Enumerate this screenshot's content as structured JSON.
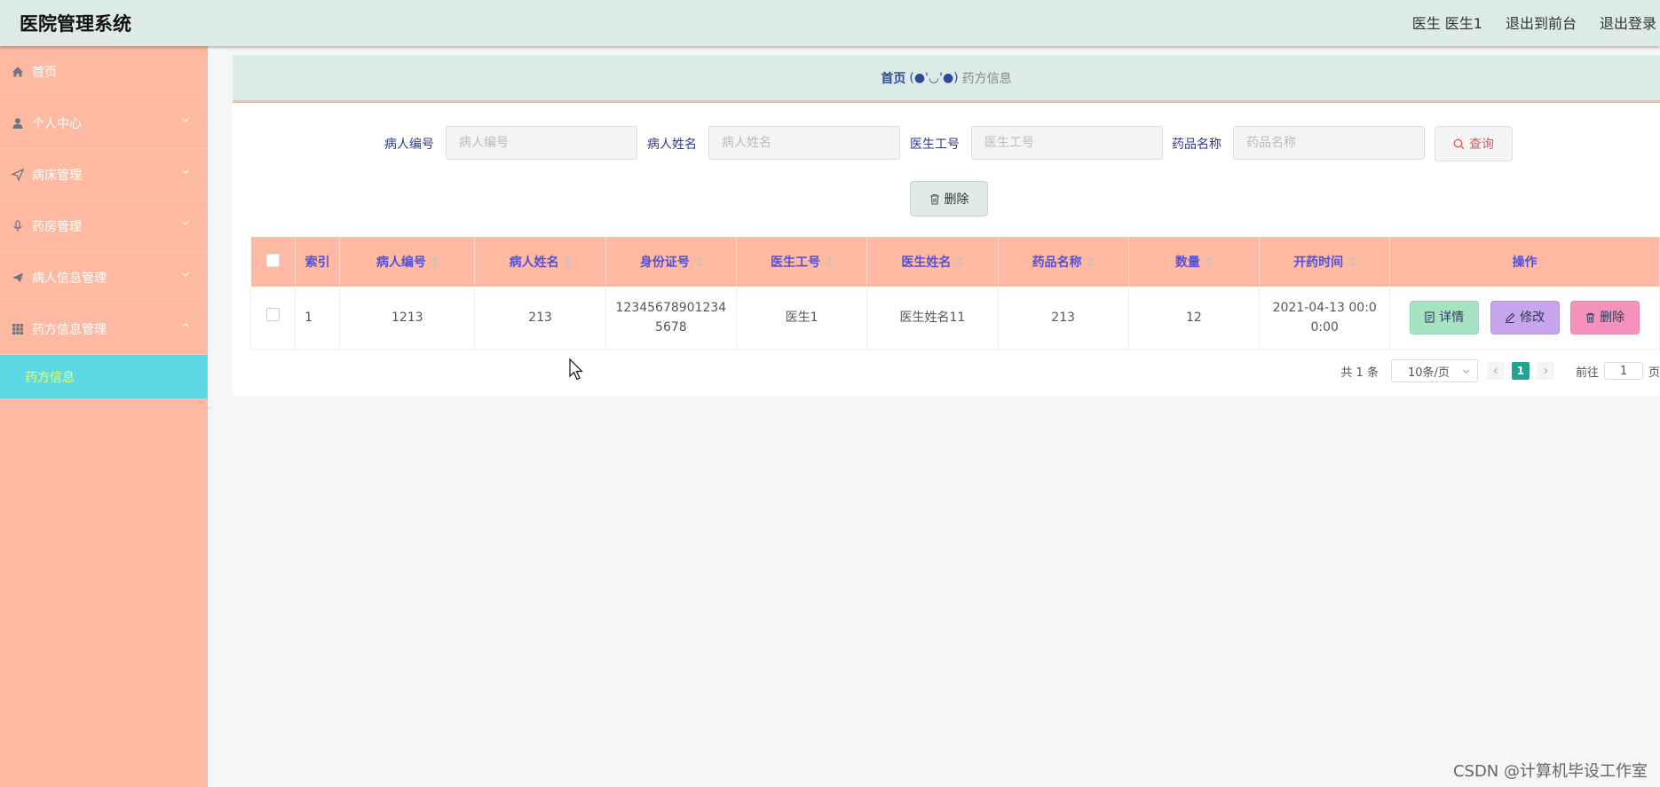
{
  "header": {
    "title": "医院管理系统",
    "user": "医生 医生1",
    "front_link": "退出到前台",
    "logout_link": "退出登录"
  },
  "sidebar": {
    "items": [
      {
        "label": "首页",
        "icon": "home-icon"
      },
      {
        "label": "个人中心",
        "icon": "user-icon",
        "expandable": true
      },
      {
        "label": "病床管理",
        "icon": "send-icon",
        "expandable": true
      },
      {
        "label": "药房管理",
        "icon": "microphone-icon",
        "expandable": true
      },
      {
        "label": "病人信息管理",
        "icon": "paper-plane-icon",
        "expandable": true
      },
      {
        "label": "药方信息管理",
        "icon": "grid-icon",
        "expandable": true,
        "expanded": true
      }
    ],
    "sub_item": "药方信息"
  },
  "breadcrumb": {
    "home": "首页",
    "face": "(●'◡'●)",
    "current": "药方信息"
  },
  "search": {
    "fields": [
      {
        "label": "病人编号",
        "placeholder": "病人编号"
      },
      {
        "label": "病人姓名",
        "placeholder": "病人姓名"
      },
      {
        "label": "医生工号",
        "placeholder": "医生工号"
      },
      {
        "label": "药品名称",
        "placeholder": "药品名称"
      }
    ],
    "query_label": "查询"
  },
  "batch_delete_label": "删除",
  "table": {
    "columns": [
      "索引",
      "病人编号",
      "病人姓名",
      "身份证号",
      "医生工号",
      "医生姓名",
      "药品名称",
      "数量",
      "开药时间",
      "操作"
    ],
    "rows": [
      {
        "index": "1",
        "patient_no": "1213",
        "patient_name": "213",
        "id_card": "123456789012345678",
        "doctor_no": "医生1",
        "doctor_name": "医生姓名11",
        "drug_name": "213",
        "quantity": "12",
        "time": "2021-04-13 00:00:00",
        "actions": {
          "detail": "详情",
          "edit": "修改",
          "delete": "删除"
        }
      }
    ]
  },
  "pagination": {
    "total": "共 1 条",
    "page_size": "10条/页",
    "current_page": "1",
    "goto_label": "前往",
    "goto_value": "1",
    "page_unit": "页"
  },
  "watermark": "CSDN @计算机毕设工作室",
  "colors": {
    "header_bg": "#dcebe5",
    "sidebar_bg": "#fdb9a1",
    "active_sub_bg": "#5ed8e5",
    "table_header_bg": "#fdb9a1",
    "page_active": "#23a28e"
  }
}
